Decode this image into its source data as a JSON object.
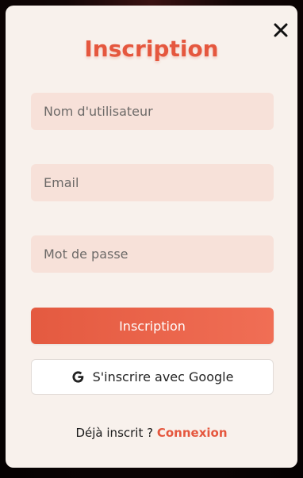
{
  "modal": {
    "title": "Inscription",
    "close_icon": "close-icon"
  },
  "form": {
    "username": {
      "placeholder": "Nom d'utilisateur"
    },
    "email": {
      "placeholder": "Email"
    },
    "password": {
      "placeholder": "Mot de passe"
    },
    "submit_label": "Inscription",
    "google_label": "S'inscrire avec Google",
    "google_icon": "google-icon"
  },
  "footer": {
    "prompt": "Déjà inscrit ?",
    "link_label": "Connexion"
  },
  "colors": {
    "accent": "#e5573e",
    "modal_background": "#f8f1ec",
    "field_background": "#f7e1d9"
  }
}
